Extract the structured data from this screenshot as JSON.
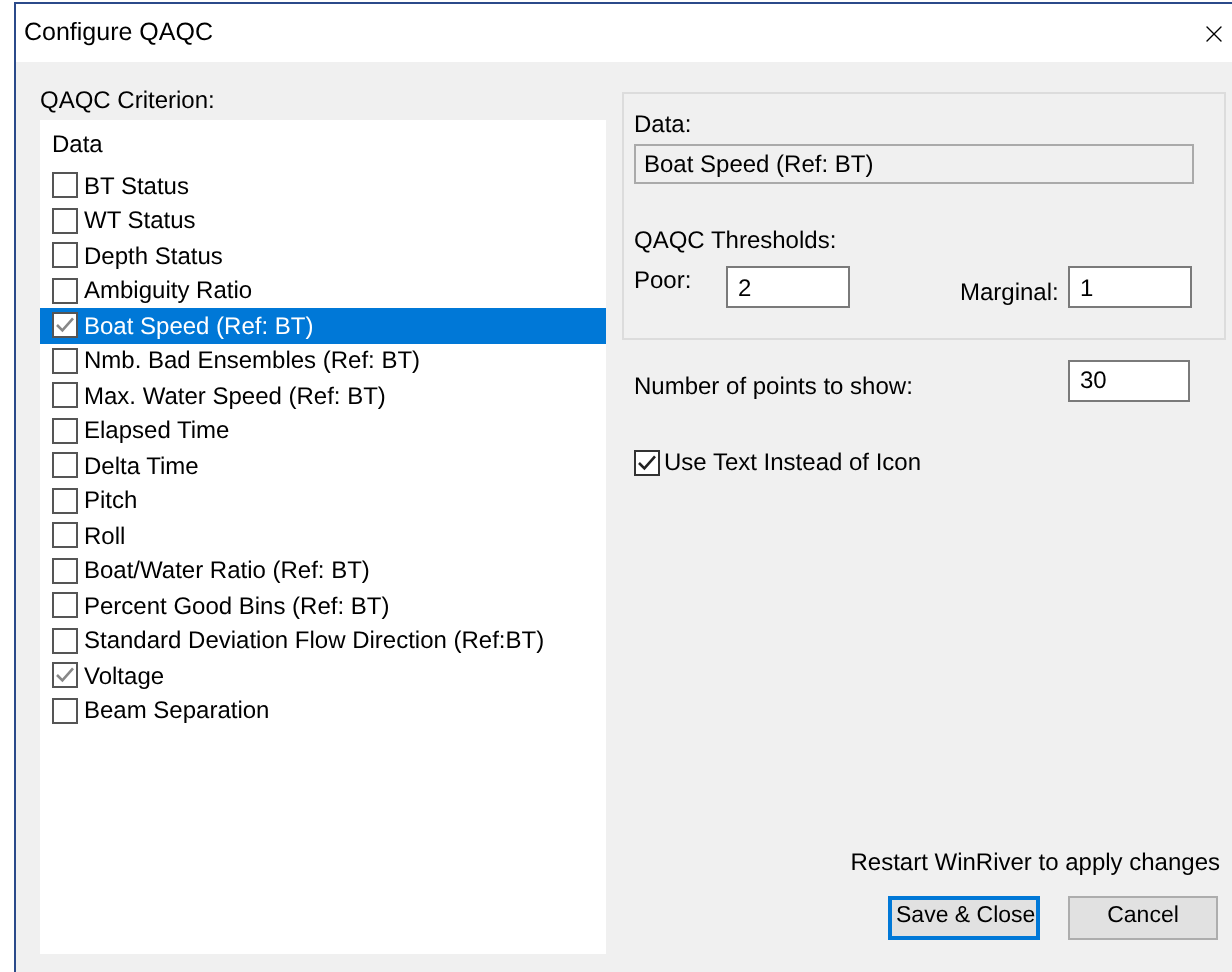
{
  "window": {
    "title": "Configure QAQC"
  },
  "criterion_label": "QAQC Criterion:",
  "list": {
    "header": "Data",
    "items": [
      {
        "label": "BT Status",
        "checked": false,
        "selected": false
      },
      {
        "label": "WT Status",
        "checked": false,
        "selected": false
      },
      {
        "label": "Depth Status",
        "checked": false,
        "selected": false
      },
      {
        "label": "Ambiguity Ratio",
        "checked": false,
        "selected": false
      },
      {
        "label": "Boat Speed (Ref: BT)",
        "checked": true,
        "selected": true
      },
      {
        "label": "Nmb. Bad Ensembles (Ref: BT)",
        "checked": false,
        "selected": false
      },
      {
        "label": "Max. Water Speed (Ref: BT)",
        "checked": false,
        "selected": false
      },
      {
        "label": "Elapsed Time",
        "checked": false,
        "selected": false
      },
      {
        "label": "Delta Time",
        "checked": false,
        "selected": false
      },
      {
        "label": "Pitch",
        "checked": false,
        "selected": false
      },
      {
        "label": "Roll",
        "checked": false,
        "selected": false
      },
      {
        "label": "Boat/Water Ratio (Ref: BT)",
        "checked": false,
        "selected": false
      },
      {
        "label": "Percent Good Bins (Ref: BT)",
        "checked": false,
        "selected": false
      },
      {
        "label": "Standard Deviation Flow Direction (Ref:BT)",
        "checked": false,
        "selected": false
      },
      {
        "label": "Voltage",
        "checked": true,
        "selected": false
      },
      {
        "label": "Beam Separation",
        "checked": false,
        "selected": false
      }
    ]
  },
  "details": {
    "data_label": "Data:",
    "data_value": "Boat Speed (Ref: BT)",
    "thresholds_label": "QAQC Thresholds:",
    "poor_label": "Poor:",
    "poor_value": "2",
    "marginal_label": "Marginal:",
    "marginal_value": "1"
  },
  "points": {
    "label": "Number of points to show:",
    "value": "30"
  },
  "use_text": {
    "label": "Use Text Instead of Icon",
    "checked": true
  },
  "note": "Restart WinRiver to apply changes",
  "buttons": [
    {
      "label": "Save & Close",
      "default": true
    },
    {
      "label": "Cancel",
      "default": false
    }
  ]
}
